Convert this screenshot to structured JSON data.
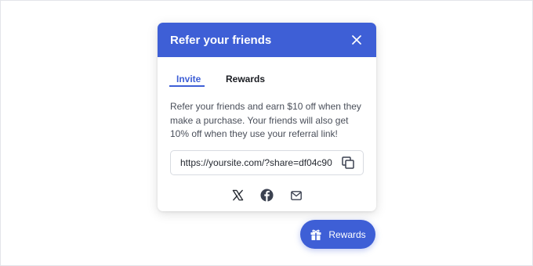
{
  "modal": {
    "title": "Refer your friends",
    "tabs": [
      {
        "label": "Invite",
        "active": true
      },
      {
        "label": "Rewards",
        "active": false
      }
    ],
    "description": "Refer your friends and earn $10 off when they make a purchase. Your friends will also get 10% off when they use your referral link!",
    "referral_link": "https://yoursite.com/?share=df04c90",
    "share_icons": [
      "x-icon",
      "facebook-icon",
      "email-icon"
    ]
  },
  "launcher": {
    "label": "Rewards",
    "icon": "gift-icon"
  },
  "colors": {
    "accent": "#3e5fd6",
    "text_dark": "#1a1c22",
    "text_body": "#4a4f5a",
    "icon_gray": "#3b4150"
  }
}
